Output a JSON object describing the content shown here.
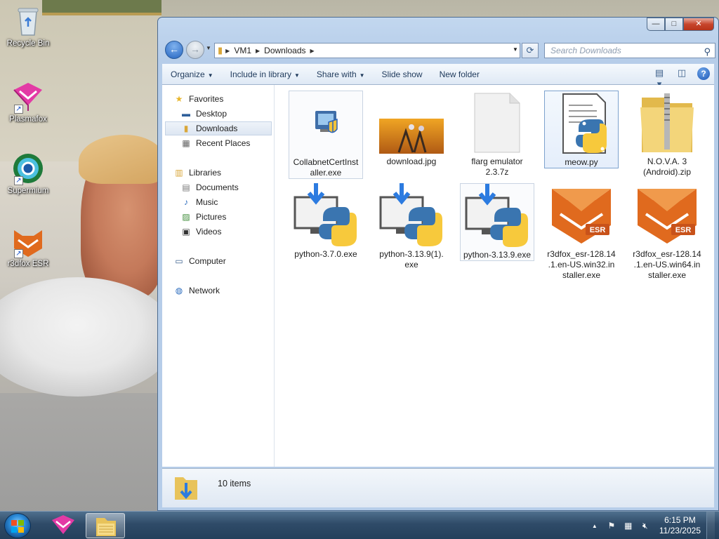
{
  "desktop": {
    "icons": [
      {
        "name": "recycle-bin-icon",
        "label": "Recycle Bin"
      },
      {
        "name": "plasmafox-icon",
        "label": "Plasmafox"
      },
      {
        "name": "supermium-icon",
        "label": "Supermium"
      },
      {
        "name": "r3dfox-esr-icon",
        "label": "r3dfox ESR"
      }
    ]
  },
  "window": {
    "caption_buttons": {
      "minimize": "—",
      "maximize": "□",
      "close": "✕"
    },
    "breadcrumb": [
      "VM1",
      "Downloads"
    ],
    "search_placeholder": "Search Downloads",
    "toolbar": {
      "organize": "Organize",
      "include_in_library": "Include in library",
      "share_with": "Share with",
      "slide_show": "Slide show",
      "new_folder": "New folder"
    },
    "nav": {
      "favorites": "Favorites",
      "desktop": "Desktop",
      "downloads": "Downloads",
      "recent_places": "Recent Places",
      "libraries": "Libraries",
      "documents": "Documents",
      "music": "Music",
      "pictures": "Pictures",
      "videos": "Videos",
      "computer": "Computer",
      "network": "Network"
    },
    "files": [
      {
        "name": "CollabnetCertInstaller.exe",
        "label": "CollabnetCertInst aller.exe",
        "icon": "installer-icon"
      },
      {
        "name": "download.jpg",
        "label": "download.jpg",
        "icon": "image-thumbnail"
      },
      {
        "name": "flarg emulator 2.3.7z",
        "label": "flarg emulator 2.3.7z",
        "icon": "blank-file-icon"
      },
      {
        "name": "meow.py",
        "label": "meow.py",
        "icon": "python-file-icon"
      },
      {
        "name": "N.O.V.A. 3 (Android).zip",
        "label": "N.O.V.A. 3 (Android).zip",
        "icon": "zip-folder-icon"
      },
      {
        "name": "python-3.7.0.exe",
        "label": "python-3.7.0.exe",
        "icon": "python-installer-icon"
      },
      {
        "name": "python-3.13.9(1).exe",
        "label": "python-3.13.9(1). exe",
        "icon": "python-installer-icon"
      },
      {
        "name": "python-3.13.9.exe",
        "label": "python-3.13.9.exe",
        "icon": "python-installer-icon"
      },
      {
        "name": "r3dfox_esr-128.14.1.en-US.win32.installer.exe",
        "label": "r3dfox_esr-128.14 .1.en-US.win32.in staller.exe",
        "icon": "r3dfox-esr-icon"
      },
      {
        "name": "r3dfox_esr-128.14.1.en-US.win64.installer.exe",
        "label": "r3dfox_esr-128.14 .1.en-US.win64.in staller.exe",
        "icon": "r3dfox-esr-icon"
      }
    ],
    "status": {
      "item_count": "10 items"
    }
  },
  "taskbar": {
    "time": "6:15 PM",
    "date": "11/23/2025",
    "tray_up_arrow": "▲"
  },
  "colors": {
    "python_blue": "#3a75b0",
    "python_yellow": "#f7c93c",
    "r3dfox_orange": "#e06a1e",
    "selection_border": "#7da2ce"
  }
}
